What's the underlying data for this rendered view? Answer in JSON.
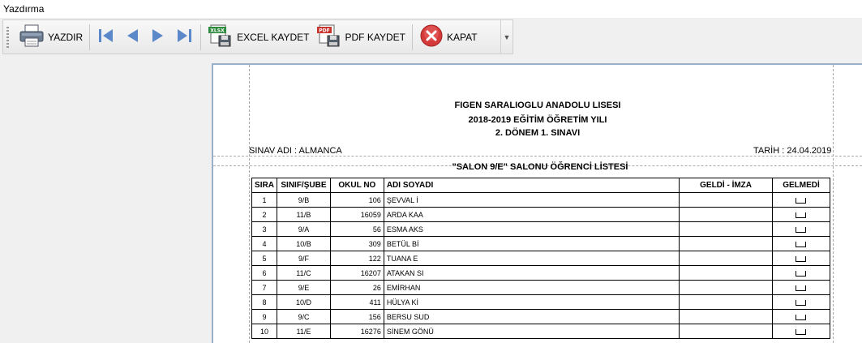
{
  "window": {
    "title": "Yazdırma"
  },
  "toolbar": {
    "print_label": "YAZDIR",
    "excel_label": "EXCEL KAYDET",
    "pdf_label": "PDF KAYDET",
    "close_label": "KAPAT",
    "excel_icon_text": "XLSX",
    "pdf_icon_text": "PDF"
  },
  "report": {
    "school_line": "FIGEN SARALIOGLU ANADOLU LİSESİ",
    "year_line": "2018-2019 EĞİTİM ÖĞRETİM YILI",
    "exam_line": "2. DÖNEM 1. SINAVI",
    "exam_name": "SINAV ADI : ALMANCA",
    "date": "TARİH : 24.04.2019",
    "list_title": "\"SALON 9/E\" SALONU ÖĞRENCİ LİSTESİ",
    "columns": [
      "SIRA",
      "SINIF/ŞUBE",
      "OKUL NO",
      "ADI SOYADI",
      "GELDİ - İMZA",
      "GELMEDİ"
    ],
    "rows": [
      {
        "sira": "1",
        "sinif": "9/B",
        "okul_no": "106",
        "adi": "ŞEVVAL İ"
      },
      {
        "sira": "2",
        "sinif": "11/B",
        "okul_no": "16059",
        "adi": "ARDA KAA"
      },
      {
        "sira": "3",
        "sinif": "9/A",
        "okul_no": "56",
        "adi": "ESMA AKS"
      },
      {
        "sira": "4",
        "sinif": "10/B",
        "okul_no": "309",
        "adi": "BETÜL Bİ"
      },
      {
        "sira": "5",
        "sinif": "9/F",
        "okul_no": "122",
        "adi": "TUANA E"
      },
      {
        "sira": "6",
        "sinif": "11/C",
        "okul_no": "16207",
        "adi": "ATAKAN SI"
      },
      {
        "sira": "7",
        "sinif": "9/E",
        "okul_no": "26",
        "adi": "EMİRHAN"
      },
      {
        "sira": "8",
        "sinif": "10/D",
        "okul_no": "411",
        "adi": "HÜLYA Kİ"
      },
      {
        "sira": "9",
        "sinif": "9/C",
        "okul_no": "156",
        "adi": "BERSU SUD"
      },
      {
        "sira": "10",
        "sinif": "11/E",
        "okul_no": "16276",
        "adi": "SİNEM GÖNÜ"
      }
    ]
  }
}
